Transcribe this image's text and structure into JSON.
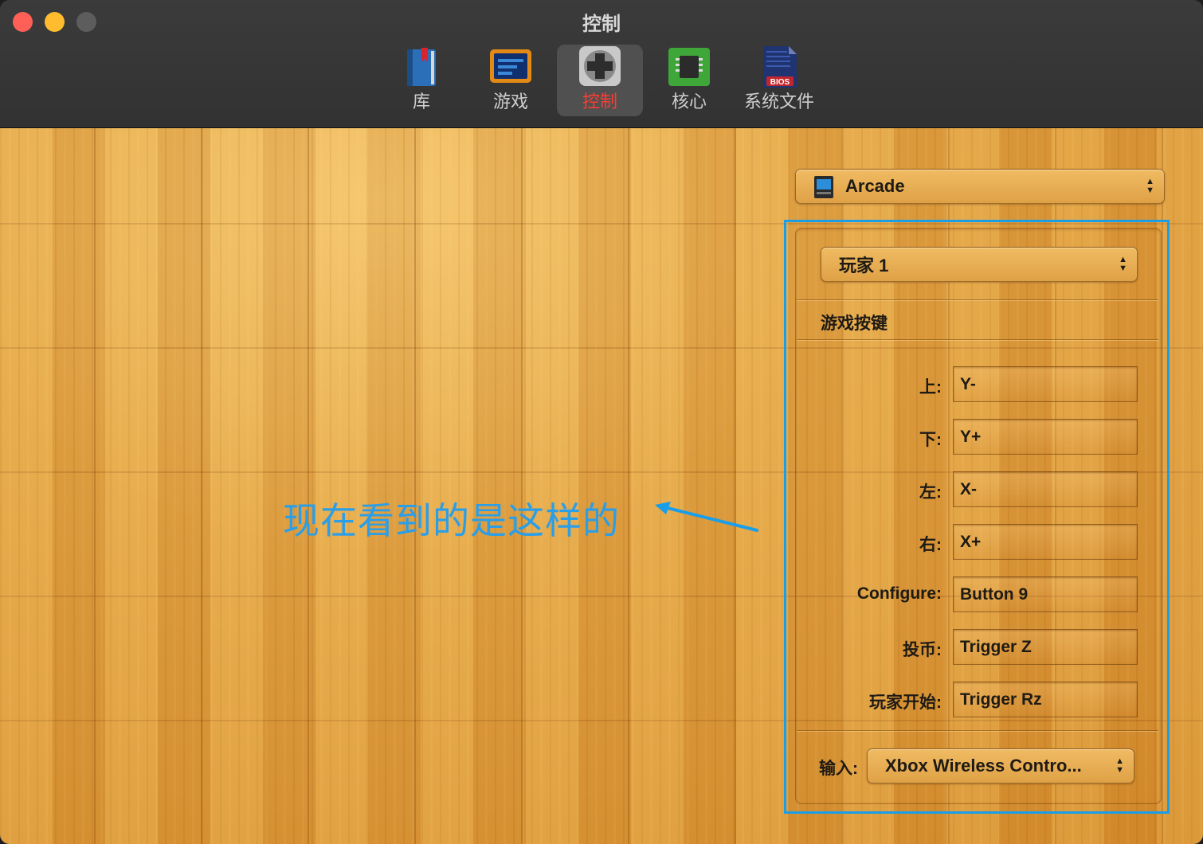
{
  "window": {
    "title": "控制"
  },
  "toolbar": {
    "items": [
      {
        "label": "库",
        "icon": "library-book-icon",
        "selected": false
      },
      {
        "label": "游戏",
        "icon": "game-screen-icon",
        "selected": false
      },
      {
        "label": "控制",
        "icon": "dpad-controller-icon",
        "selected": true
      },
      {
        "label": "核心",
        "icon": "cpu-chip-icon",
        "selected": false
      },
      {
        "label": "系统文件",
        "icon": "bios-file-icon",
        "selected": false
      }
    ],
    "bios_badge": "BIOS"
  },
  "system_selector": {
    "value": "Arcade",
    "icon": "arcade-cabinet-icon"
  },
  "player_selector": {
    "value": "玩家 1"
  },
  "section": {
    "title": "游戏按键"
  },
  "bindings": [
    {
      "label": "上:",
      "value": "Y-"
    },
    {
      "label": "下:",
      "value": "Y+"
    },
    {
      "label": "左:",
      "value": "X-"
    },
    {
      "label": "右:",
      "value": "X+"
    },
    {
      "label": "Configure:",
      "value": "Button 9"
    },
    {
      "label": "投币:",
      "value": "Trigger Z"
    },
    {
      "label": "玩家开始:",
      "value": "Trigger Rz"
    }
  ],
  "input": {
    "label": "输入:",
    "value": "Xbox Wireless Contro..."
  },
  "annotation": {
    "text": "现在看到的是这样的"
  },
  "colors": {
    "accent_selected": "#ff3b30",
    "annotation_blue": "#1a9ee8",
    "wood": "#e2a444"
  }
}
